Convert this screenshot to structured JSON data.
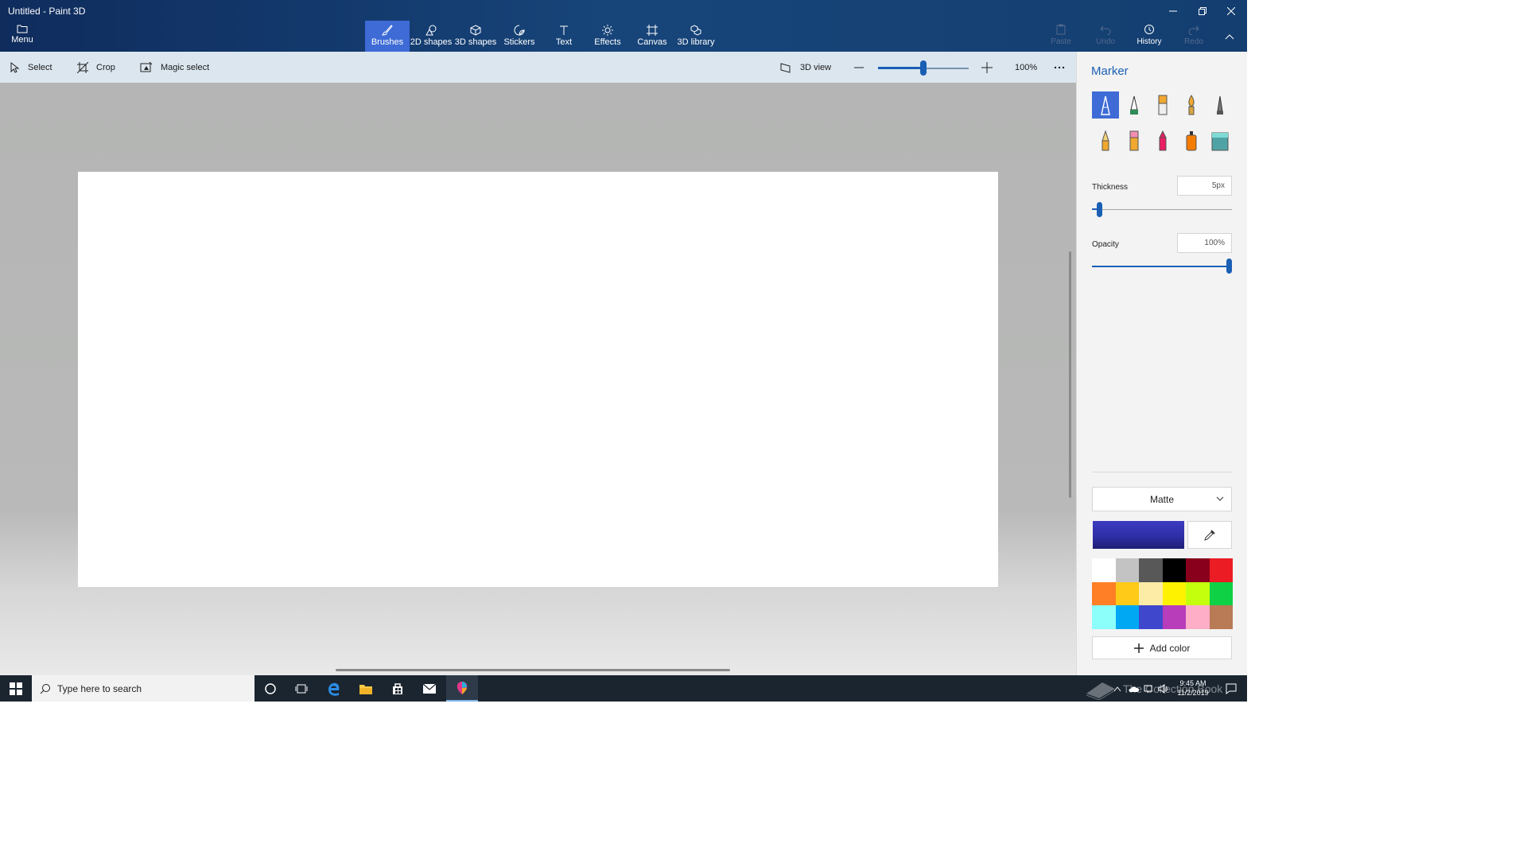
{
  "window": {
    "title": "Untitled - Paint 3D",
    "minimize_icon": "minimize-icon",
    "restore_icon": "restore-icon",
    "close_icon": "close-icon"
  },
  "ribbon": {
    "menu_label": "Menu",
    "tabs": [
      {
        "label": "Brushes",
        "icon": "brush-icon",
        "active": true
      },
      {
        "label": "2D shapes",
        "icon": "2d-shapes-icon",
        "active": false
      },
      {
        "label": "3D shapes",
        "icon": "3d-shapes-icon",
        "active": false
      },
      {
        "label": "Stickers",
        "icon": "sticker-icon",
        "active": false
      },
      {
        "label": "Text",
        "icon": "text-icon",
        "active": false
      },
      {
        "label": "Effects",
        "icon": "effects-icon",
        "active": false
      },
      {
        "label": "Canvas",
        "icon": "canvas-icon",
        "active": false
      },
      {
        "label": "3D library",
        "icon": "3d-library-icon",
        "active": false
      }
    ],
    "right_tools": [
      {
        "label": "Paste",
        "enabled": false
      },
      {
        "label": "Undo",
        "enabled": false
      },
      {
        "label": "History",
        "enabled": true
      },
      {
        "label": "Redo",
        "enabled": false
      }
    ],
    "collapse_icon": "chevron-up-icon"
  },
  "toolbar": {
    "select_label": "Select",
    "crop_label": "Crop",
    "magic_select_label": "Magic select",
    "view_3d_label": "3D view",
    "zoom_value": "100%",
    "zoom_level": 0.5,
    "more_icon": "more-icon"
  },
  "panel": {
    "title": "Marker",
    "brushes": [
      {
        "name": "marker",
        "active": true
      },
      {
        "name": "calligraphy-pen",
        "active": false
      },
      {
        "name": "oil-brush",
        "active": false
      },
      {
        "name": "watercolor",
        "active": false
      },
      {
        "name": "pixel-pen",
        "active": false
      },
      {
        "name": "pencil",
        "active": false
      },
      {
        "name": "eraser",
        "active": false
      },
      {
        "name": "crayon",
        "active": false
      },
      {
        "name": "spray-can",
        "active": false
      },
      {
        "name": "fill",
        "active": false
      }
    ],
    "thickness": {
      "label": "Thickness",
      "value": "5px",
      "level": 0.05
    },
    "opacity": {
      "label": "Opacity",
      "value": "100%",
      "level": 1.0
    },
    "finish": "Matte",
    "current_color": "#2e2ea8",
    "palette": [
      "#ffffff",
      "#c3c3c3",
      "#585858",
      "#000000",
      "#88001b",
      "#ec1c24",
      "#ff7f27",
      "#ffca18",
      "#fdeca6",
      "#fff200",
      "#c4ff0e",
      "#0ed145",
      "#8cfffb",
      "#00a8f3",
      "#3f48cc",
      "#b83dba",
      "#ffaec8",
      "#b97a56"
    ],
    "add_color_label": "Add color"
  },
  "taskbar": {
    "search_placeholder": "Type here to search",
    "time": "9:45 AM",
    "date": "11/2/2019",
    "watermark": "The Collection Book"
  },
  "colors": {
    "accent": "#3e6bd6",
    "link_blue": "#1a5fb4",
    "ribbon_dark": "#0f2c5d"
  }
}
